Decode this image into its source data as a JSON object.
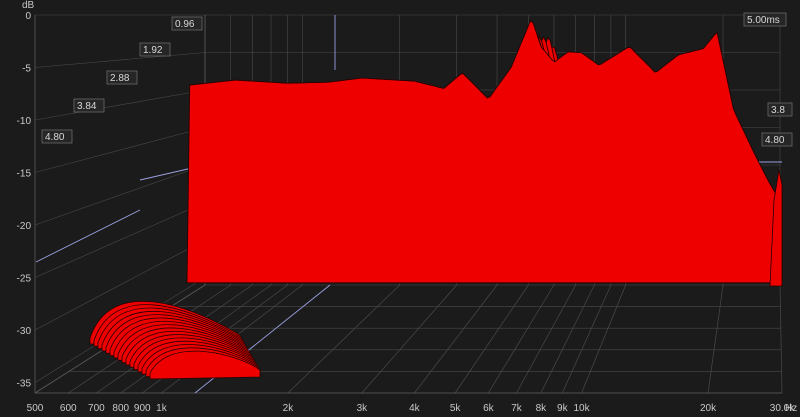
{
  "chart_data": {
    "type": "waterfall",
    "x_unit": "Hz",
    "y_unit": "dB",
    "x_range": [
      500,
      30000
    ],
    "x_scale": "log",
    "y_range": [
      -36,
      0
    ],
    "x_ticks": [
      {
        "value": 500,
        "label": "500"
      },
      {
        "value": 600,
        "label": "600"
      },
      {
        "value": 700,
        "label": "700"
      },
      {
        "value": 800,
        "label": "800"
      },
      {
        "value": 900,
        "label": "900"
      },
      {
        "value": 1000,
        "label": "1k"
      },
      {
        "value": 2000,
        "label": "2k"
      },
      {
        "value": 3000,
        "label": "3k"
      },
      {
        "value": 4000,
        "label": "4k"
      },
      {
        "value": 5000,
        "label": "5k"
      },
      {
        "value": 6000,
        "label": "6k"
      },
      {
        "value": 7000,
        "label": "7k"
      },
      {
        "value": 8000,
        "label": "8k"
      },
      {
        "value": 9000,
        "label": "9k"
      },
      {
        "value": 10000,
        "label": "10k"
      },
      {
        "value": 20000,
        "label": "20k"
      },
      {
        "value": 30000,
        "label": "30.0k"
      }
    ],
    "y_ticks": [
      {
        "value": 0,
        "label": "0"
      },
      {
        "value": -5,
        "label": "-5"
      },
      {
        "value": -10,
        "label": "-10"
      },
      {
        "value": -15,
        "label": "-15"
      },
      {
        "value": -20,
        "label": "-20"
      },
      {
        "value": -25,
        "label": "-25"
      },
      {
        "value": -30,
        "label": "-30"
      },
      {
        "value": -35,
        "label": "-35"
      }
    ],
    "time_unit": "ms",
    "time_ticks_left": [
      {
        "value": 0.96,
        "label": "0.96"
      },
      {
        "value": 1.92,
        "label": "1.92"
      },
      {
        "value": 2.88,
        "label": "2.88"
      },
      {
        "value": 3.84,
        "label": "3.84"
      },
      {
        "value": 4.8,
        "label": "4.80"
      }
    ],
    "time_ticks_right": [
      {
        "value": 5.0,
        "label": "5.00ms"
      },
      {
        "value": 3.84,
        "label": "3.8"
      },
      {
        "value": 4.8,
        "label": "4.80"
      }
    ],
    "slice_count": 14,
    "surface_color": "#ee0000",
    "slice_line_color": "#2a0000",
    "grid_color": "#4a4a4a",
    "front_spectrum_db": [
      [
        1100,
        -25.2
      ],
      [
        1150,
        -6.7
      ],
      [
        1500,
        -6.2
      ],
      [
        2000,
        -6.5
      ],
      [
        2500,
        -6.4
      ],
      [
        3000,
        -6.0
      ],
      [
        4000,
        -6.3
      ],
      [
        4700,
        -7.0
      ],
      [
        5200,
        -5.5
      ],
      [
        6000,
        -8.0
      ],
      [
        6800,
        -5.0
      ],
      [
        7300,
        -2.0
      ],
      [
        7600,
        -0.3
      ],
      [
        8000,
        -3.0
      ],
      [
        8600,
        -4.5
      ],
      [
        9300,
        -3.5
      ],
      [
        10000,
        -3.6
      ],
      [
        11000,
        -4.8
      ],
      [
        13000,
        -3.0
      ],
      [
        15000,
        -5.5
      ],
      [
        17000,
        -3.8
      ],
      [
        19500,
        -3.2
      ],
      [
        21000,
        -1.6
      ],
      [
        23000,
        -9.0
      ],
      [
        26000,
        -13.5
      ],
      [
        28000,
        -16.0
      ],
      [
        30000,
        -18.0
      ]
    ]
  }
}
